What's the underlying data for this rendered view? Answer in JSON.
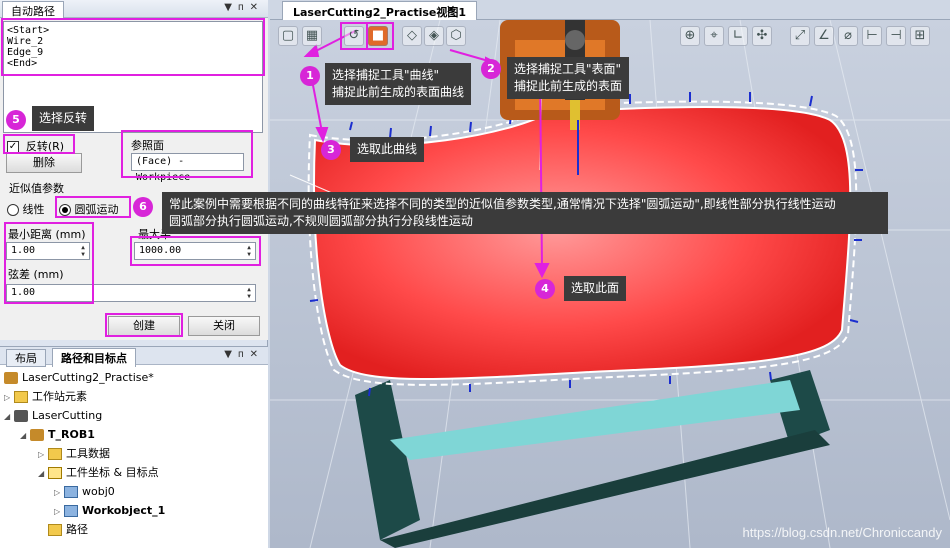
{
  "route_panel": {
    "title": "自动路径",
    "list_items": [
      "<Start>",
      "Wire_2",
      "Edge_9",
      "<End>"
    ],
    "reverse_label": "反转(R)",
    "reverse_checked": true,
    "delete_button": "删除",
    "ref_surface_label": "参照面",
    "ref_surface_value": "(Face) - Workpiece",
    "approx_label": "近似值参数",
    "option_linear": "线性",
    "option_arc": "圆弧运动",
    "selected_option": "圆弧运动",
    "min_distance_label": "最小距离 (mm)",
    "min_distance_value": "1.00",
    "max_radius_label": "最大半",
    "max_radius_value": "1000.00",
    "chord_label": "弦差 (mm)",
    "chord_value": "1.00",
    "create_button": "创建",
    "close_button": "关闭"
  },
  "tree_panel": {
    "tabs": [
      "布局",
      "路径和目标点"
    ],
    "active_tab": "路径和目标点",
    "items": [
      {
        "label": "LaserCutting2_Practise*",
        "icon": "station-icon",
        "level": 0,
        "bold": false
      },
      {
        "label": "工作站元素",
        "icon": "folder-icon",
        "level": 0,
        "bold": false
      },
      {
        "label": "LaserCutting",
        "icon": "controller-icon",
        "level": 0,
        "bold": false
      },
      {
        "label": "T_ROB1",
        "icon": "task-icon",
        "level": 1,
        "bold": true
      },
      {
        "label": "工具数据",
        "icon": "tooldata-icon",
        "level": 2,
        "bold": false
      },
      {
        "label": "工件坐标 & 目标点",
        "icon": "frame-icon",
        "level": 2,
        "bold": false
      },
      {
        "label": "wobj0",
        "icon": "wobj-icon",
        "level": 3,
        "bold": false
      },
      {
        "label": "Workobject_1",
        "icon": "wobj-icon",
        "level": 3,
        "bold": true
      },
      {
        "label": "路径",
        "icon": "path-folder-icon",
        "level": 2,
        "bold": false
      }
    ]
  },
  "view": {
    "tab_title": "LaserCutting2_Practise视图1",
    "watermark": "https://blog.csdn.net/Chroniccandy"
  },
  "annotations": {
    "step1": {
      "num": "1",
      "line1": "选择捕捉工具\"曲线\"",
      "line2": "捕捉此前生成的表面曲线"
    },
    "step2": {
      "num": "2",
      "line1": "选择捕捉工具\"表面\"",
      "line2": "捕捉此前生成的表面"
    },
    "step3": {
      "num": "3",
      "text": "选取此曲线"
    },
    "step4": {
      "num": "4",
      "text": "选取此面"
    },
    "step5": {
      "num": "5",
      "text": "选择反转"
    },
    "step6": {
      "num": "6",
      "line1": "常此案例中需要根据不同的曲线特征来选择不同的类型的近似值参数类型,通常情况下选择\"圆弧运动\",即线性部分执行线性运动",
      "line2": "圆弧部分执行圆弧运动,不规则圆弧部分执行分段线性运动"
    }
  },
  "colors": {
    "highlight": "#e020e0",
    "workpiece": "#ff3b3b",
    "callout_bg": "#3b3b3b"
  }
}
